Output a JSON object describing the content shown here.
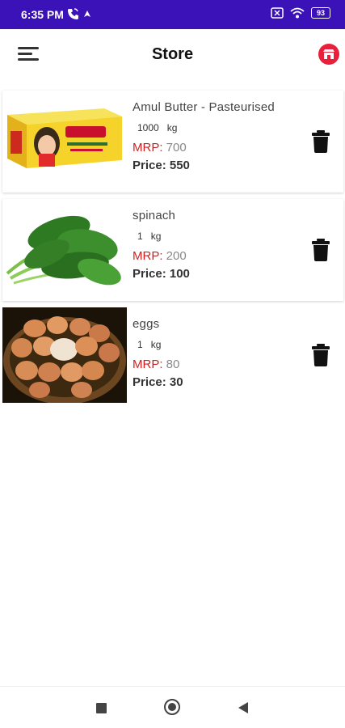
{
  "status_bar": {
    "time": "6:35 PM",
    "battery": "93",
    "left_icons": [
      "phone-wifi-icon",
      "navigation-icon"
    ],
    "right_icons": [
      "sim-icon",
      "wifi-icon",
      "battery-icon"
    ],
    "background": "#3b12b8"
  },
  "app_bar": {
    "title": "Store",
    "menu_icon": "menu-icon",
    "cart_icon": "store-cart-icon",
    "cart_color": "#e8203c"
  },
  "products": [
    {
      "name": "Amul Butter - Pasteurised",
      "quantity": "1000",
      "unit": "kg",
      "mrp_label": "MRP:",
      "mrp": "700",
      "price_label": "Price:",
      "price": "550",
      "image": "butter-box-image"
    },
    {
      "name": "spinach",
      "quantity": "1",
      "unit": "kg",
      "mrp_label": "MRP:",
      "mrp": "200",
      "price_label": "Price:",
      "price": "100",
      "image": "spinach-image"
    },
    {
      "name": "eggs",
      "quantity": "1",
      "unit": "kg",
      "mrp_label": "MRP:",
      "mrp": "80",
      "price_label": "Price:",
      "price": "30",
      "image": "eggs-basket-image"
    }
  ],
  "nav_bar": {
    "icons": [
      "recent-apps-icon",
      "home-icon",
      "back-icon"
    ]
  },
  "colors": {
    "mrp_label": "#d11f1f",
    "accent": "#3b12b8"
  }
}
